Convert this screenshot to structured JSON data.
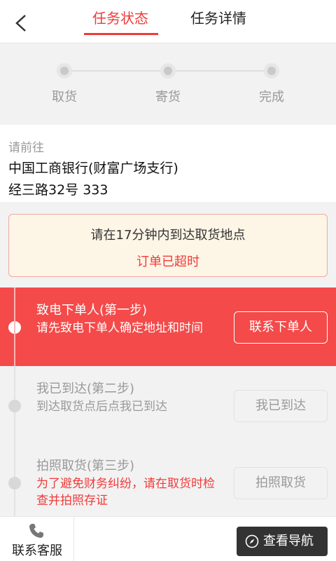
{
  "header": {
    "tabs": [
      "任务状态",
      "任务详情"
    ],
    "active_tab": 0
  },
  "progress": {
    "stages": [
      "取货",
      "寄货",
      "完成"
    ]
  },
  "destination": {
    "hint": "请前往",
    "name": "中国工商银行(财富广场支行)",
    "address": "经三路32号 333"
  },
  "notice": {
    "countdown": "请在17分钟内到达取货地点",
    "status": "订单已超时"
  },
  "steps": [
    {
      "title": "致电下单人(第一步)",
      "desc": "请先致电下单人确定地址和时间",
      "button": "联系下单人",
      "active": true
    },
    {
      "title": "我已到达(第二步)",
      "desc": "到达取货点后点我已到达",
      "button": "我已到达",
      "active": false
    },
    {
      "title": "拍照取货(第三步)",
      "desc": "为了避免财务纠纷，请在取货时检查并拍照存证",
      "button": "拍照取货",
      "active": false
    }
  ],
  "bottom": {
    "service_label": "联系客服",
    "nav_label": "查看导航"
  },
  "colors": {
    "accent": "#f23a3a",
    "active_step_bg": "#f44a4a",
    "notice_bg": "#fdf5e6",
    "nav_button_bg": "#333333"
  },
  "icons": {
    "back": "chevron-left-icon",
    "service": "phone-icon",
    "navigation": "compass-icon"
  }
}
